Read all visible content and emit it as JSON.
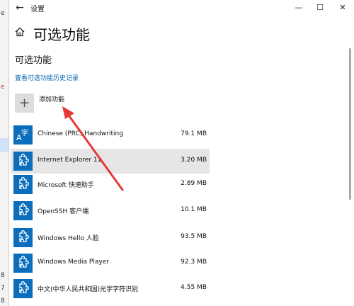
{
  "window": {
    "title": "设置",
    "back_glyph": "←",
    "minimize_glyph": "—",
    "maximize_glyph": "☐",
    "close_glyph": "✕"
  },
  "page": {
    "title": "可选功能",
    "section_title": "可选功能",
    "history_link": "查看可选功能历史记录",
    "add_feature": "添加功能",
    "add_glyph": "+"
  },
  "features": [
    {
      "name": "Chinese (PRC) Handwriting",
      "size": "79.1 MB",
      "icon": "handwriting-icon",
      "selected": false
    },
    {
      "name": "Internet Explorer 11",
      "size": "3.20 MB",
      "icon": "puzzle-icon",
      "selected": true
    },
    {
      "name": "Microsoft 快速助手",
      "size": "2.89 MB",
      "icon": "puzzle-icon",
      "selected": false
    },
    {
      "name": "OpenSSH 客户端",
      "size": "10.1 MB",
      "icon": "puzzle-icon",
      "selected": false
    },
    {
      "name": "Windows Hello 人脸",
      "size": "93.5 MB",
      "icon": "puzzle-icon",
      "selected": false
    },
    {
      "name": "Windows Media Player",
      "size": "92.3 MB",
      "icon": "puzzle-icon",
      "selected": false
    },
    {
      "name": "中文(中华人民共和国)光学字符识别",
      "size": "4.55 MB",
      "icon": "puzzle-icon",
      "selected": false
    }
  ],
  "handwriting_glyphs": {
    "a": "A",
    "zi": "字"
  },
  "background_fragments": [
    "e",
    "e",
    "8",
    "7",
    "8"
  ],
  "colors": {
    "accent": "#0a6ebd",
    "link": "#0063b1",
    "selected_row": "#e6e6e6",
    "annotation_arrow": "#e53935"
  }
}
